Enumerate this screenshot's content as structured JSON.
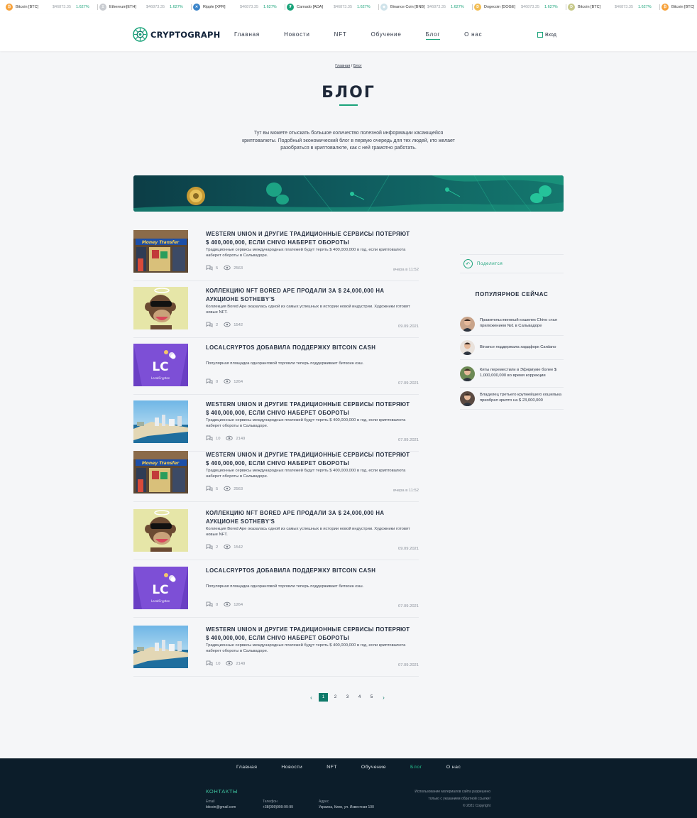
{
  "ticker": [
    {
      "name": "Bitcoin [BTC]",
      "price": "$46873.35",
      "change": "1.627%",
      "color": "#f7a23b",
      "sym": "₿"
    },
    {
      "name": "Ethereum[ETH]",
      "price": "$46873.35",
      "change": "1.627%",
      "color": "#c9ccd1",
      "sym": "Ξ"
    },
    {
      "name": "Ripple [XPR]",
      "price": "$46873.35",
      "change": "1.627%",
      "color": "#3a84c9",
      "sym": "✕"
    },
    {
      "name": "Carnado [ADA]",
      "price": "$46873.35",
      "change": "1.627%",
      "color": "#1aa37a",
      "sym": "₮"
    },
    {
      "name": "Binance Coin [BNB]",
      "price": "$46873.35",
      "change": "1.627%",
      "color": "#cfe3ea",
      "sym": "◆"
    },
    {
      "name": "Dogecoin [DOGE]",
      "price": "$46873.35",
      "change": "1.627%",
      "color": "#f2bd53",
      "sym": "D"
    },
    {
      "name": "Bitcoin [BTC]",
      "price": "$46873.35",
      "change": "1.627%",
      "color": "#c7c98a",
      "sym": "D"
    },
    {
      "name": "Bitcoin [BTC]",
      "price": "",
      "change": "",
      "color": "#f7a23b",
      "sym": "₿"
    }
  ],
  "logo": "CRYPTOGRAPH",
  "nav": [
    {
      "label": "Главная",
      "active": false
    },
    {
      "label": "Новости",
      "active": false
    },
    {
      "label": "NFT",
      "active": false
    },
    {
      "label": "Обучение",
      "active": false
    },
    {
      "label": "Блог",
      "active": true
    },
    {
      "label": "О нас",
      "active": false
    }
  ],
  "login": "Вход",
  "breadcrumbs": {
    "home": "Главная",
    "sep": " / ",
    "current": "Блог"
  },
  "page_title": "БЛОГ",
  "intro": "Тут вы можете отыскать большое количество полезной информации касающейся криптовалюты. Подобный экономический блог в первую очередь для тех людей, кто желает разобраться в криптовалюте, как с ней грамотно работать.",
  "posts": [
    {
      "title": "WESTERN UNION И ДРУГИЕ ТРАДИЦИОННЫЕ СЕРВИСЫ ПОТЕРЯЮТ $ 400,000,000, ЕСЛИ CHIVO НАБЕРЕТ ОБОРОТЫ",
      "excerpt": "Традиционные сервисы международных платежей будут терять $ 400,000,000 в год, если криптовалюта наберет обороты в Сальвадоре.",
      "comments": "5",
      "views": "2563",
      "date": "вчера в 11:52",
      "img": "shop"
    },
    {
      "title": "КОЛЛЕКЦИЮ NFT BORED APE ПРОДАЛИ ЗА $ 24,000,000 НА АУКЦИОНЕ SOTHEBY'S",
      "excerpt": "Коллекция Bored Ape оказалась одной из самых успешных в истории новой индустрии. Художники готовят новые NFT.",
      "comments": "2",
      "views": "1542",
      "date": "09.09.2021",
      "img": "ape"
    },
    {
      "title": "LOCALCRYPTOS ДОБАВИЛА ПОДДЕРЖКУ BITCOIN CASH",
      "excerpt": "Популярная площадка одноранговой торговли теперь поддерживает биткоин кэш.",
      "comments": "0",
      "views": "1264",
      "date": "07.09.2021",
      "img": "lc"
    },
    {
      "title": "WESTERN UNION И ДРУГИЕ ТРАДИЦИОННЫЕ СЕРВИСЫ ПОТЕРЯЮТ $ 400,000,000, ЕСЛИ CHIVO НАБЕРЕТ ОБОРОТЫ",
      "excerpt": "Традиционные сервисы международных платежей будут терять $ 400,000,000 в год, если криптовалюта наберет обороты в Сальвадоре.",
      "comments": "10",
      "views": "2149",
      "date": "07.09.2021",
      "img": "beach"
    },
    {
      "title": "WESTERN UNION И ДРУГИЕ ТРАДИЦИОННЫЕ СЕРВИСЫ ПОТЕРЯЮТ $ 400,000,000, ЕСЛИ CHIVO НАБЕРЕТ ОБОРОТЫ",
      "excerpt": "Традиционные сервисы международных платежей будут терять $ 400,000,000 в год, если криптовалюта наберет обороты в Сальвадоре.",
      "comments": "5",
      "views": "2563",
      "date": "вчера в 11:52",
      "img": "shop"
    },
    {
      "title": "КОЛЛЕКЦИЮ NFT BORED APE ПРОДАЛИ ЗА $ 24,000,000 НА АУКЦИОНЕ SOTHEBY'S",
      "excerpt": "Коллекция Bored Ape оказалась одной из самых успешных в истории новой индустрии. Художники готовят новые NFT.",
      "comments": "2",
      "views": "1542",
      "date": "09.09.2021",
      "img": "ape"
    },
    {
      "title": "LOCALCRYPTOS ДОБАВИЛА ПОДДЕРЖКУ BITCOIN CASH",
      "excerpt": "Популярная площадка одноранговой торговли теперь поддерживает биткоин кэш.",
      "comments": "0",
      "views": "1264",
      "date": "07.09.2021",
      "img": "lc"
    },
    {
      "title": "WESTERN UNION И ДРУГИЕ ТРАДИЦИОННЫЕ СЕРВИСЫ ПОТЕРЯЮТ $ 400,000,000, ЕСЛИ CHIVO НАБЕРЕТ ОБОРОТЫ",
      "excerpt": "Традиционные сервисы международных платежей будут терять $ 400,000,000 в год, если криптовалюта наберет обороты в Сальвадоре.",
      "comments": "10",
      "views": "2149",
      "date": "07.09.2021",
      "img": "beach"
    }
  ],
  "thumb_text": {
    "shop_sign": "Money Transfer",
    "lc_mark": "LC",
    "lc_name": "LocalCryptos"
  },
  "share": "Поделится",
  "popular_title": "ПОПУЛЯРНОЕ СЕЙЧАС",
  "popular": [
    {
      "text": "Правительственный кошелек Chivo стал приложением №1 в Сальвадоре"
    },
    {
      "text": "Binance поддержала хардфорк Cardano"
    },
    {
      "text": "Киты переместили в Эфириуме более $ 1,000,000,000 во время коррекции"
    },
    {
      "text": "Владелец третьего крупнейшего кошелька приобрел крипто на $ 23,000,000"
    }
  ],
  "pagination": {
    "pages": [
      "1",
      "2",
      "3",
      "4",
      "5"
    ],
    "current": "1",
    "prev": "‹",
    "next": "›"
  },
  "footer": {
    "nav": [
      {
        "label": "Главная",
        "active": false
      },
      {
        "label": "Новости",
        "active": false
      },
      {
        "label": "NFT",
        "active": false
      },
      {
        "label": "Обучение",
        "active": false
      },
      {
        "label": "Блог",
        "active": true
      },
      {
        "label": "О нас",
        "active": false
      }
    ],
    "contacts_title": "КОНТАКТЫ",
    "email_label": "Email",
    "email": "bitcoin@gmail.com",
    "phone_label": "Телефон",
    "phone": "+38(099)999-99-99",
    "address_label": "Адрес",
    "address": "Украина, Киев, ул. Известная 100",
    "copy1": "Использование материалов сайта разрешено",
    "copy2": "только с указанием обратной ссылки!",
    "copy3": "© 2021 Copyright"
  },
  "colors": {
    "accent": "#1aa37a",
    "footer_bg": "#0c1d2a",
    "pager_active": "#0f7a6a"
  }
}
